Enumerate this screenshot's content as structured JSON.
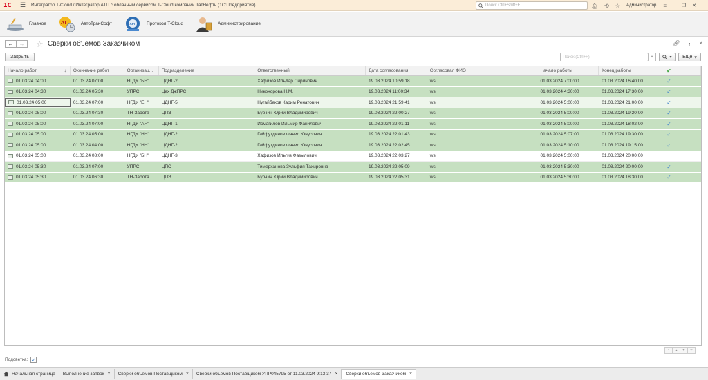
{
  "titlebar": {
    "logo": "1С",
    "title": "Интегратор T-Cloud / Интегратор АТП с облачным сервисом T-Cloud компании ТатНефть  (1С:Предприятие)",
    "search_placeholder": "Поиск Ctrl+Shift+F",
    "user": "Администратор"
  },
  "sections": [
    {
      "label": "Главное",
      "icon": "main-section-icon"
    },
    {
      "label": "АвтоТранСофт",
      "icon": "autotransoft-icon"
    },
    {
      "label": "Протокол T-Cloud",
      "icon": "api-protocol-icon"
    },
    {
      "label": "Администрирование",
      "icon": "admin-icon"
    }
  ],
  "page": {
    "title": "Сверки объемов Заказчиком",
    "close_label": "Закрыть",
    "search_placeholder": "Поиск (Ctrl+F)",
    "search_clear": "×",
    "more_label": "Еще",
    "highlight_label": "Подсветка:",
    "highlight_checked": true
  },
  "table": {
    "columns": [
      "Начало работ",
      "Окончание работ",
      "Организац...",
      "Подразделение",
      "Ответственный",
      "Дата согласования",
      "Согласовал ФИО",
      "Начало работы",
      "Конец работы",
      "✔"
    ],
    "sort_indicator": "↓",
    "rows": [
      {
        "start": "01.03.24 04:00",
        "end": "01.03.24 07:00",
        "org": "НГДУ \"БН\"",
        "dept": "ЦДНГ-2",
        "resp": "Хафизов Ильдар Сиринович",
        "date": "19.03.2024 10:59:18",
        "fio": "ws",
        "wstart": "01.03.2024 7:00:00",
        "wend": "01.03.2024 16:40:00",
        "check": "✓",
        "highlight": true
      },
      {
        "start": "01.03.24 04:30",
        "end": "01.03.24 05:30",
        "org": "УПРС",
        "dept": "Цех ДжПРС",
        "resp": "Никонорова Н.М.",
        "date": "19.03.2024 11:00:34",
        "fio": "ws",
        "wstart": "01.03.2024 4:30:00",
        "wend": "01.03.2024 17:30:00",
        "check": "✓",
        "highlight": true
      },
      {
        "start": "01.03.24 05:00",
        "end": "01.03.24 07:00",
        "org": "НГДУ \"ЕН\"",
        "dept": "ЦДНГ-5",
        "resp": "Нугайбеков Карим Ренатович",
        "date": "19.03.2024 21:59:41",
        "fio": "ws",
        "wstart": "01.03.2024 5:00:00",
        "wend": "01.03.2024 21:00:00",
        "check": "✓",
        "highlight": true,
        "current": true
      },
      {
        "start": "01.03.24 05:00",
        "end": "01.03.24 07:30",
        "org": "ТН-Забота",
        "dept": "ЦПЭ",
        "resp": "Бурчин Юрий Владимирович",
        "date": "19.03.2024 22:00:27",
        "fio": "ws",
        "wstart": "01.03.2024 5:00:00",
        "wend": "01.03.2024 19:20:00",
        "check": "✓",
        "highlight": true
      },
      {
        "start": "01.03.24 05:00",
        "end": "01.03.24 07:00",
        "org": "НГДУ \"АН\"",
        "dept": "ЦДНГ-1",
        "resp": "Исмагилов Ильмир Фанилович",
        "date": "19.03.2024 22:01:11",
        "fio": "ws",
        "wstart": "01.03.2024 5:00:00",
        "wend": "01.03.2024 18:02:00",
        "check": "✓",
        "highlight": true
      },
      {
        "start": "01.03.24 05:00",
        "end": "01.03.24 05:00",
        "org": "НГДУ \"НН\"",
        "dept": "ЦДНГ-2",
        "resp": "Гайфутдинов Фанис Юнусович",
        "date": "19.03.2024 22:01:43",
        "fio": "ws",
        "wstart": "01.03.2024 5:07:00",
        "wend": "01.03.2024 19:30:00",
        "check": "✓",
        "highlight": true
      },
      {
        "start": "01.03.24 05:00",
        "end": "01.03.24 04:00",
        "org": "НГДУ \"НН\"",
        "dept": "ЦДНГ-2",
        "resp": "Гайфутдинов Фанис Юнусович",
        "date": "19.03.2024 22:02:45",
        "fio": "ws",
        "wstart": "01.03.2024 5:10:00",
        "wend": "01.03.2024 19:15:00",
        "check": "✓",
        "highlight": true
      },
      {
        "start": "01.03.24 05:00",
        "end": "01.03.24 08:00",
        "org": "НГДУ \"БН\"",
        "dept": "ЦДНГ-3",
        "resp": "Хафизов Ильгиз Фазылович",
        "date": "19.03.2024 22:03:27",
        "fio": "ws",
        "wstart": "01.03.2024 5:00:00",
        "wend": "01.03.2024 20:00:00",
        "check": "",
        "highlight": false
      },
      {
        "start": "01.03.24 05:30",
        "end": "01.03.24 07:00",
        "org": "УПРС",
        "dept": "ЦПО",
        "resp": "Тимерханова Зульфия Тахировна",
        "date": "19.03.2024 22:05:09",
        "fio": "ws",
        "wstart": "01.03.2024 5:30:00",
        "wend": "01.03.2024 20:00:00",
        "check": "✓",
        "highlight": true
      },
      {
        "start": "01.03.24 05:30",
        "end": "01.03.24 06:30",
        "org": "ТН-Забота",
        "dept": "ЦПЭ",
        "resp": "Бурчин Юрий Владимирович",
        "date": "19.03.2024 22:05:31",
        "fio": "ws",
        "wstart": "01.03.2024 5:30:00",
        "wend": "01.03.2024 18:30:00",
        "check": "✓",
        "highlight": true
      }
    ]
  },
  "taskbar": [
    {
      "label": "Начальная страница",
      "closable": false,
      "active": false
    },
    {
      "label": "Выполнение заявок",
      "closable": true,
      "active": false
    },
    {
      "label": "Сверки объемов Поставщиком",
      "closable": true,
      "active": false
    },
    {
      "label": "Сверки объемов Поставщиком УПР045795 от 11.03.2024 9:13:37",
      "closable": true,
      "active": false
    },
    {
      "label": "Сверки объемов Заказчиком",
      "closable": true,
      "active": true
    }
  ],
  "colors": {
    "row_highlight": "#c6e0c1",
    "titlebar": "#fbedd8",
    "check": "#4f8ccc"
  }
}
